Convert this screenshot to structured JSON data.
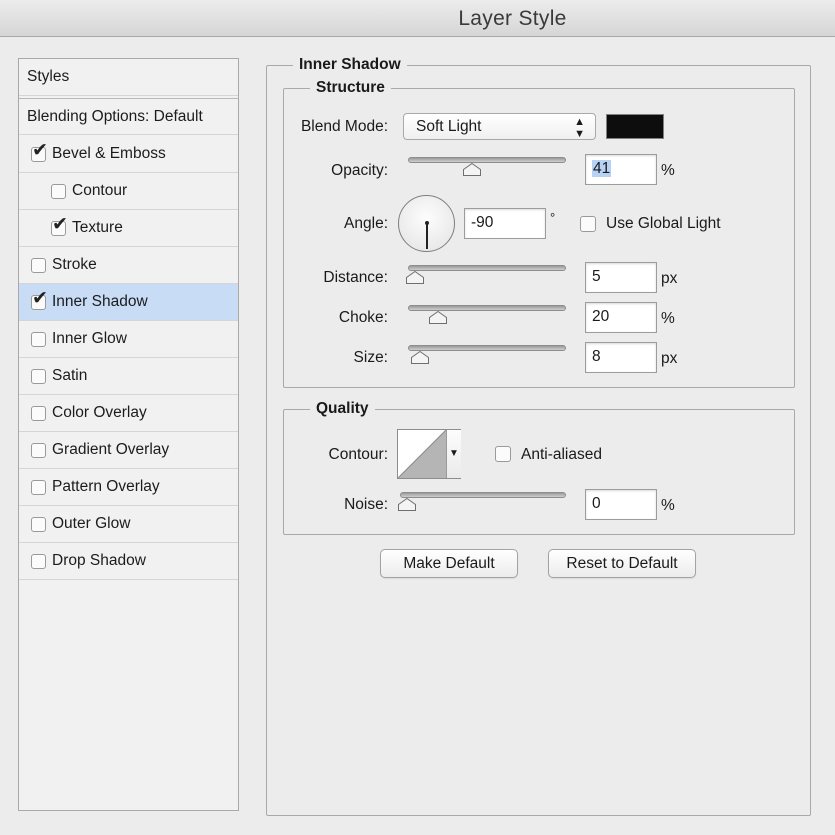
{
  "window": {
    "title": "Layer Style"
  },
  "sidebar": {
    "styles_label": "Styles",
    "blending_label": "Blending Options: Default",
    "items": [
      {
        "label": "Bevel & Emboss",
        "checked": true
      },
      {
        "label": "Contour",
        "checked": false
      },
      {
        "label": "Texture",
        "checked": true
      },
      {
        "label": "Stroke",
        "checked": false
      },
      {
        "label": "Inner Shadow",
        "checked": true,
        "selected": true
      },
      {
        "label": "Inner Glow",
        "checked": false
      },
      {
        "label": "Satin",
        "checked": false
      },
      {
        "label": "Color Overlay",
        "checked": false
      },
      {
        "label": "Gradient Overlay",
        "checked": false
      },
      {
        "label": "Pattern Overlay",
        "checked": false
      },
      {
        "label": "Outer Glow",
        "checked": false
      },
      {
        "label": "Drop Shadow",
        "checked": false
      }
    ]
  },
  "panel": {
    "title": "Inner Shadow",
    "structure": {
      "title": "Structure",
      "blend_mode_label": "Blend Mode:",
      "blend_mode_value": "Soft Light",
      "blend_color": "#0d0d0d",
      "opacity_label": "Opacity:",
      "opacity_value": "41",
      "opacity_unit": "%",
      "angle_label": "Angle:",
      "angle_value": "-90",
      "angle_unit": "°",
      "use_global_light_label": "Use Global Light",
      "use_global_light": false,
      "distance_label": "Distance:",
      "distance_value": "5",
      "distance_unit": "px",
      "choke_label": "Choke:",
      "choke_value": "20",
      "choke_unit": "%",
      "size_label": "Size:",
      "size_value": "8",
      "size_unit": "px"
    },
    "quality": {
      "title": "Quality",
      "contour_label": "Contour:",
      "anti_aliased_label": "Anti-aliased",
      "anti_aliased": false,
      "noise_label": "Noise:",
      "noise_value": "0",
      "noise_unit": "%"
    },
    "buttons": {
      "make_default": "Make Default",
      "reset_default": "Reset to Default"
    }
  }
}
